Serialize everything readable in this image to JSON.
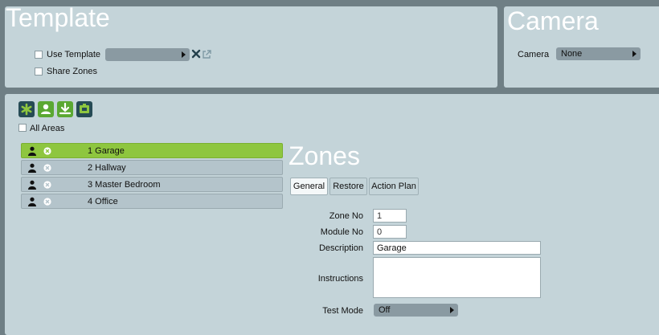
{
  "template": {
    "title": "Template",
    "use_template_label": "Use Template",
    "template_select_value": "",
    "share_zones_label": "Share Zones"
  },
  "camera": {
    "title": "Camera",
    "label": "Camera",
    "value": "None"
  },
  "areas": {
    "all_areas_label": "All Areas",
    "toolbar": [
      "add-icon",
      "user-icon",
      "download-icon",
      "module-icon"
    ]
  },
  "zones_list": [
    {
      "number": "1",
      "name": "Garage",
      "label": "1 Garage",
      "selected": true
    },
    {
      "number": "2",
      "name": "Hallway",
      "label": "2 Hallway",
      "selected": false
    },
    {
      "number": "3",
      "name": "Master Bedroom",
      "label": "3 Master Bedroom",
      "selected": false
    },
    {
      "number": "4",
      "name": "Office",
      "label": "4 Office",
      "selected": false
    }
  ],
  "zones": {
    "title": "Zones",
    "tabs": [
      "General",
      "Restore",
      "Action Plan"
    ],
    "active_tab": "General",
    "fields": {
      "zone_no_label": "Zone No",
      "zone_no_value": "1",
      "module_no_label": "Module No",
      "module_no_value": "0",
      "description_label": "Description",
      "description_value": "Garage",
      "instructions_label": "Instructions",
      "instructions_value": "",
      "test_mode_label": "Test Mode",
      "test_mode_value": "Off"
    }
  },
  "colors": {
    "background": "#6f7f85",
    "panel": "#c4d4d9",
    "selected_row": "#8ec63f",
    "toolbar_green": "#5aa832",
    "toolbar_dark": "#264b55"
  }
}
